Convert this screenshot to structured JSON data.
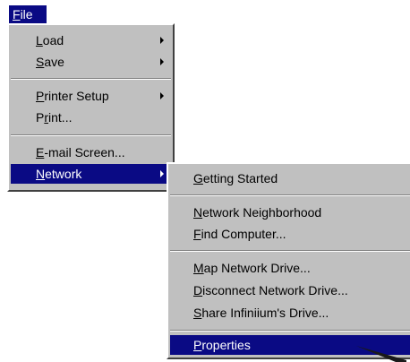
{
  "menubar": {
    "file": {
      "access": "F",
      "rest": "ile"
    }
  },
  "file_menu": {
    "items": [
      {
        "access": "L",
        "rest": "oad"
      },
      {
        "access": "S",
        "rest": "ave"
      },
      {
        "access": "P",
        "rest": "rinter Setup"
      },
      {
        "pre": "P",
        "access": "r",
        "rest": "int..."
      },
      {
        "access": "E",
        "rest": "-mail Screen..."
      },
      {
        "access": "N",
        "rest": "etwork"
      }
    ]
  },
  "network_menu": {
    "items": [
      {
        "access": "G",
        "rest": "etting Started"
      },
      {
        "access": "N",
        "rest": "etwork Neighborhood"
      },
      {
        "access": "F",
        "rest": "ind Computer..."
      },
      {
        "access": "M",
        "rest": "ap Network Drive..."
      },
      {
        "access": "D",
        "rest": "isconnect Network Drive..."
      },
      {
        "access": "S",
        "rest": "hare Infiniium's Drive..."
      },
      {
        "access": "P",
        "rest": "roperties"
      }
    ]
  },
  "colors": {
    "menu_face": "#c0c0c0",
    "highlight": "#0a0a84"
  },
  "icons": {
    "submenu": "triangle-right-icon",
    "pointer": "mouse-pointer-icon"
  }
}
